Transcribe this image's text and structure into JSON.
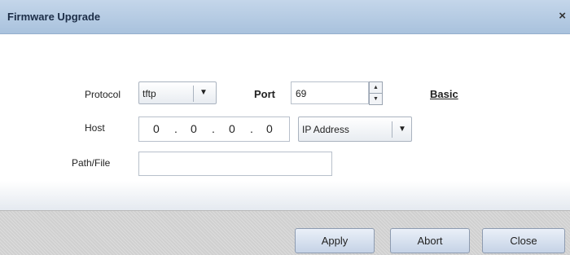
{
  "dialog": {
    "title": "Firmware Upgrade",
    "close_glyph": "×"
  },
  "form": {
    "protocol_label": "Protocol",
    "protocol_value": "tftp",
    "port_label": "Port",
    "port_value": "69",
    "mode_link": "Basic",
    "host_label": "Host",
    "host_ip": [
      "0",
      "0",
      "0",
      "0"
    ],
    "host_type_value": "IP Address",
    "path_label": "Path/File",
    "path_value": ""
  },
  "buttons": {
    "apply": "Apply",
    "abort": "Abort",
    "close": "Close"
  },
  "icons": {
    "dropdown": "caret-down-icon",
    "spin_up": "caret-up-icon",
    "spin_down": "caret-down-icon",
    "close": "close-icon"
  }
}
